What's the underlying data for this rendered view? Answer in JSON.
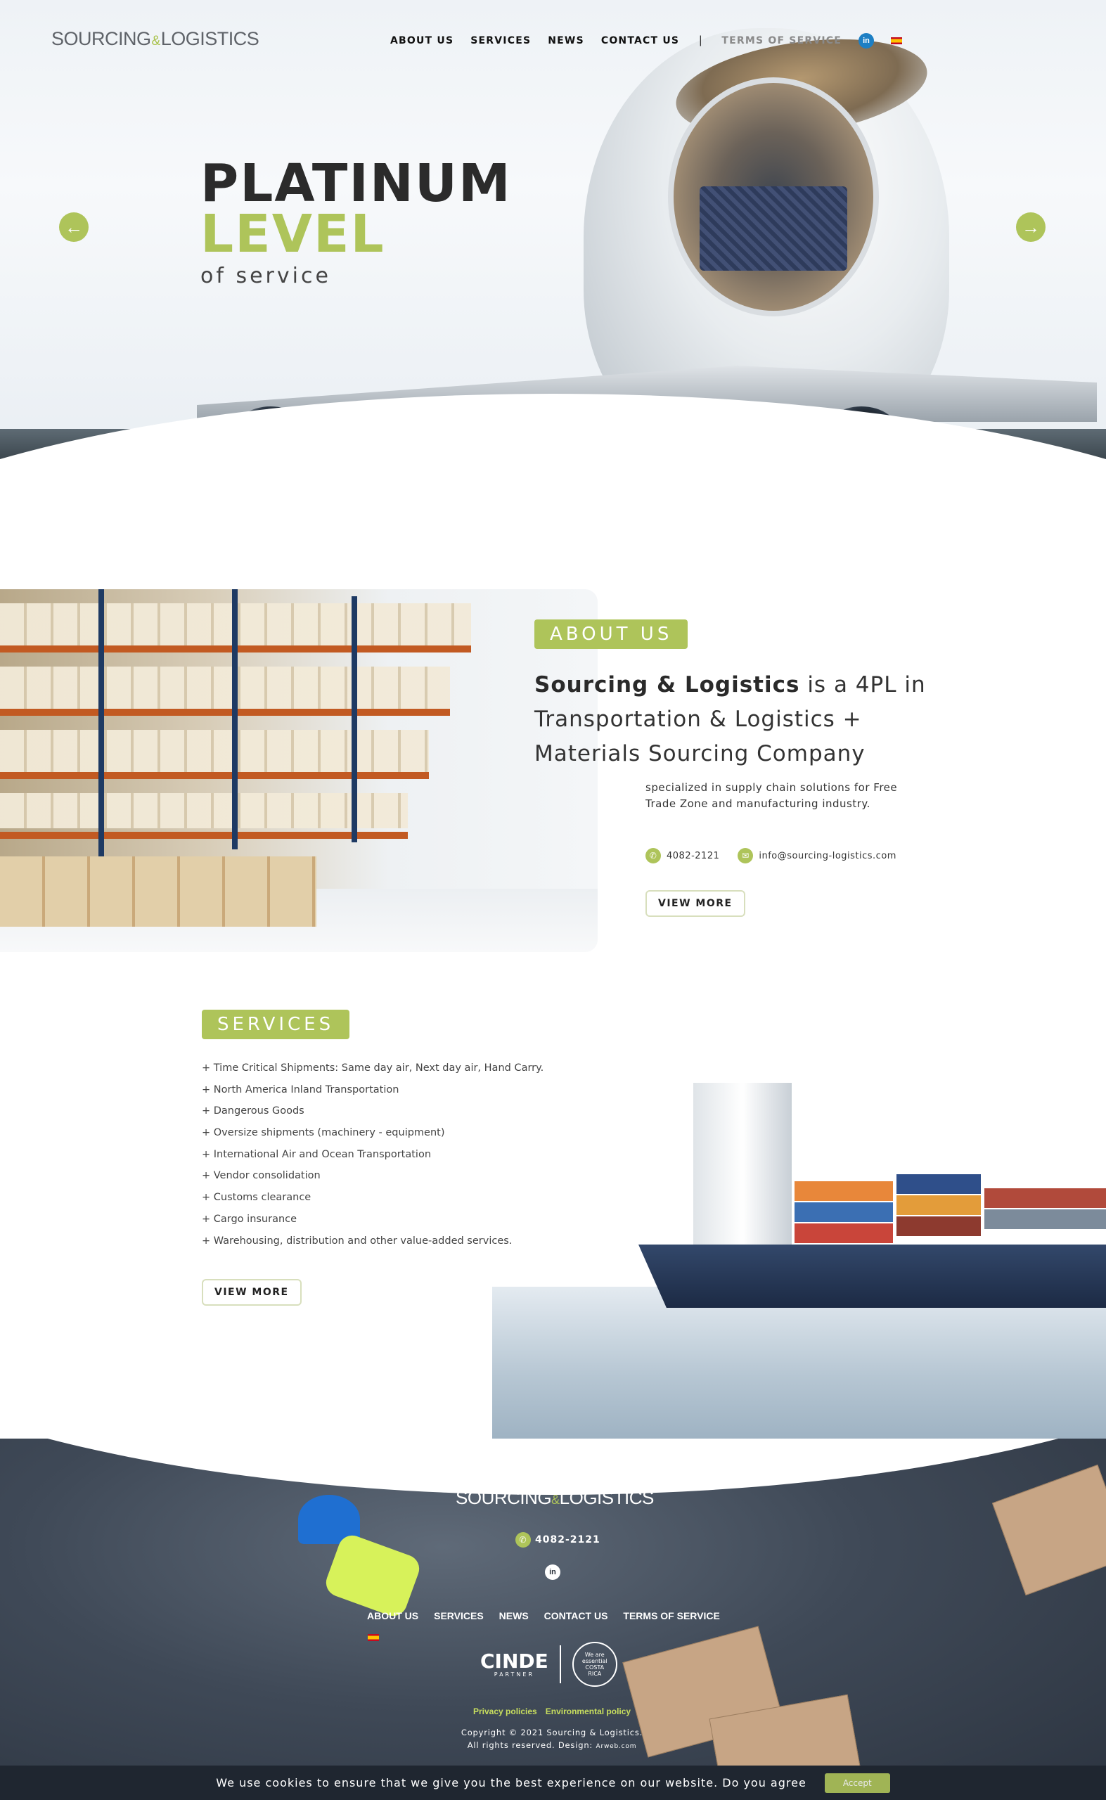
{
  "header": {
    "logo_left": "SOURCING",
    "logo_amp": "&",
    "logo_right": "LOGISTICS",
    "nav": [
      "ABOUT US",
      "SERVICES",
      "NEWS",
      "CONTACT US"
    ],
    "separator": "|",
    "terms": "TERMS OF SERVICE",
    "social_icon": "in"
  },
  "hero": {
    "line1": "PLATINUM",
    "line2": "LEVEL",
    "line3": "of service",
    "arrow_left": "←",
    "arrow_right": "→"
  },
  "about": {
    "tag": "ABOUT US",
    "heading_bold": "Sourcing & Logistics",
    "heading_rest": " is a 4PL in Transportation & Logistics + Materials Sourcing Company",
    "description": "specialized in supply chain solutions for Free Trade Zone and manufacturing industry.",
    "phone": "4082-2121",
    "email": "info@sourcing-logistics.com",
    "button": "VIEW MORE"
  },
  "services": {
    "tag": "SERVICES",
    "items": [
      "+ Time Critical Shipments: Same day air, Next day air, Hand Carry.",
      "+ North America Inland Transportation",
      "+ Dangerous Goods",
      "+ Oversize shipments (machinery - equipment)",
      "+ International Air and Ocean Transportation",
      "+ Vendor consolidation",
      "+ Customs clearance",
      "+ Cargo insurance",
      "+ Warehousing, distribution and other value-added services."
    ],
    "button": "VIEW MORE"
  },
  "footer": {
    "logo_left": "SOURCING",
    "logo_amp": "&",
    "logo_right": "LOGISTICS",
    "phone": "4082-2121",
    "social_icon": "in",
    "nav": [
      "ABOUT US",
      "SERVICES",
      "NEWS",
      "CONTACT US",
      "TERMS OF SERVICE"
    ],
    "partner_name": "CINDE",
    "partner_sub": "PARTNER",
    "badge_line1": "We are",
    "badge_line2": "essential",
    "badge_line3": "COSTA",
    "badge_line4": "RICA",
    "policies": [
      "Privacy policies",
      "Environmental policy"
    ],
    "copyright_line1": "Copyright © 2021 Sourcing & Logistics.",
    "copyright_line2": "All rights reserved. Design: ",
    "designer": "Arweb.com"
  },
  "cookie": {
    "message": "We use cookies to ensure that we give you the best experience on our website. Do you agree",
    "accept": "Accept"
  },
  "colors": {
    "accent": "#aec45a",
    "dark": "#2b2b2b",
    "footer_bg": "#3f4957",
    "cookie_bg": "#1f2630"
  }
}
